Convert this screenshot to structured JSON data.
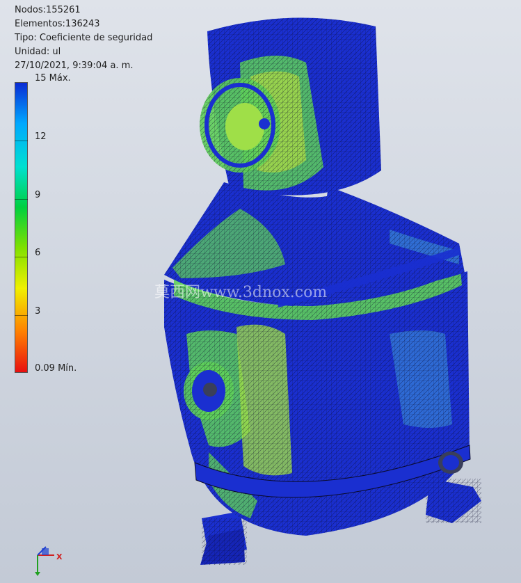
{
  "info": {
    "nodes": "Nodos:155261",
    "elements": "Elementos:136243",
    "type": "Tipo: Coeficiente de seguridad",
    "unit": "Unidad: ul",
    "datetime": "27/10/2021, 9:39:04 a. m."
  },
  "legend": {
    "max_label": "15 Máx.",
    "min_label": "0.09 Mín.",
    "ticks": [
      "12",
      "9",
      "6",
      "3"
    ],
    "colors": [
      "#0a2bd4",
      "#00a8ff",
      "#00e0d0",
      "#00d040",
      "#7fe000",
      "#f0f000",
      "#ff8000",
      "#e81010"
    ]
  },
  "watermark": "莫西网www.3dnox.com",
  "triad": {
    "x_label": "X"
  },
  "colors": {
    "vessel_blue": "#1a2fd0",
    "stress_green": "#5fd25a",
    "stress_yellow": "#c6e63a",
    "background": "#d5dae3"
  }
}
